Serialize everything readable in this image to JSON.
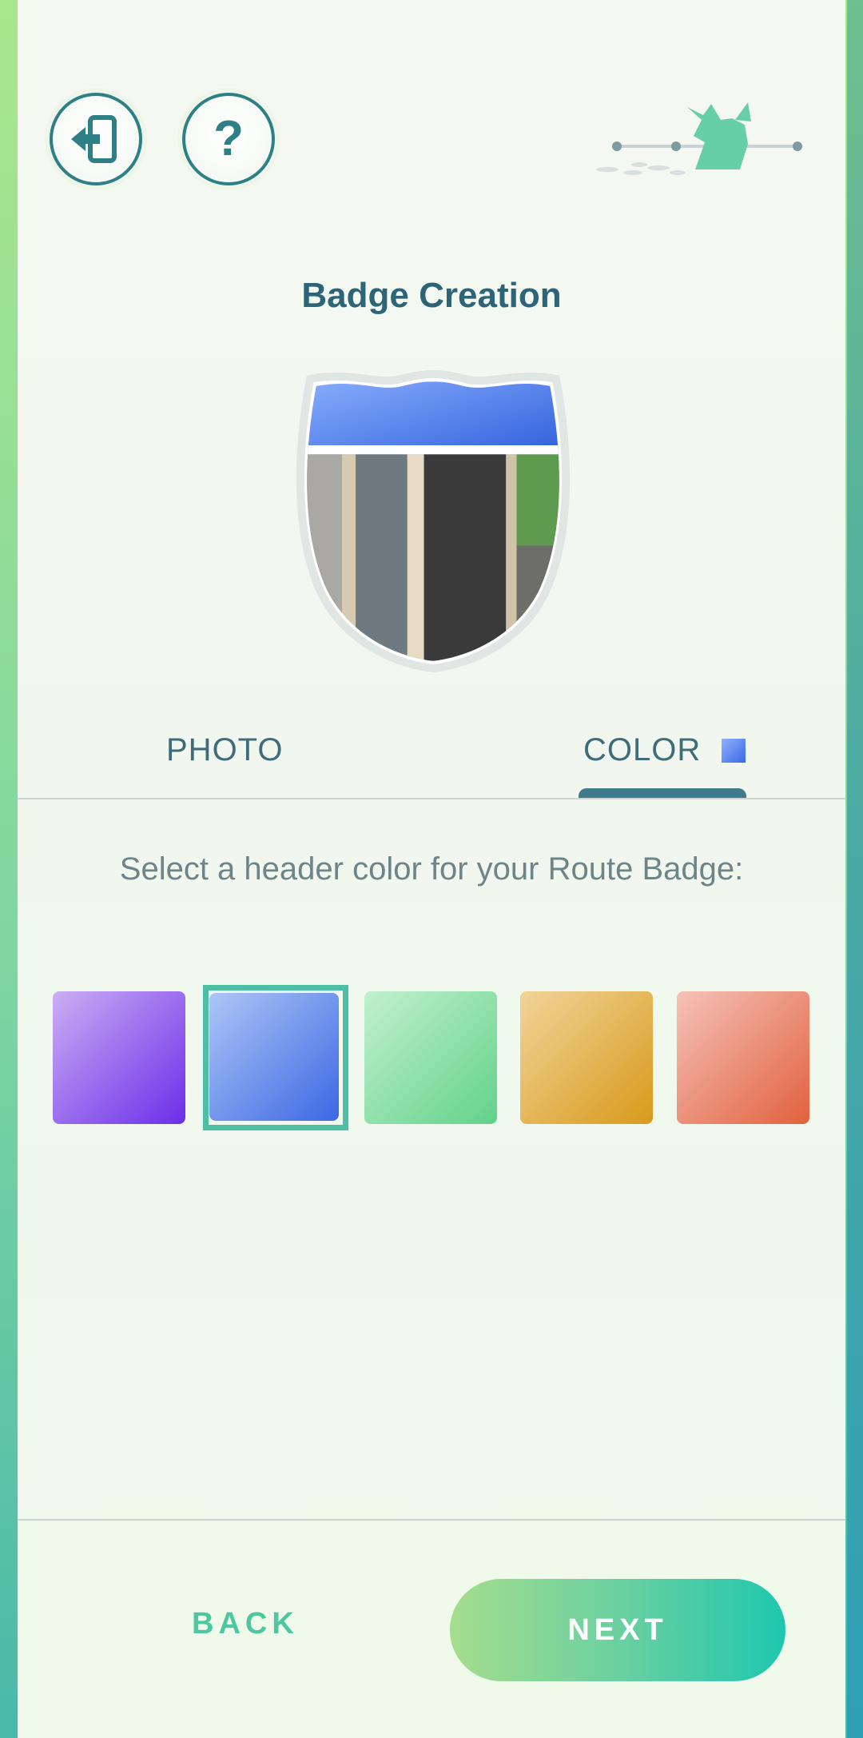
{
  "header": {
    "exit_icon": "exit-door-icon",
    "help_icon": "question-mark-icon",
    "help_glyph": "?",
    "progress_icon": "pikachu-progress-icon"
  },
  "title": "Badge Creation",
  "badge": {
    "header_color": "#4a7fe6",
    "preview_icon": "route-badge-preview"
  },
  "tabs": [
    {
      "label": "PHOTO",
      "selected": false
    },
    {
      "label": "COLOR",
      "selected": true
    }
  ],
  "instruction": "Select a header color for your Route Badge:",
  "swatches": [
    {
      "name": "purple",
      "from": "#cdaef5",
      "to": "#6a2ee8",
      "selected": false
    },
    {
      "name": "blue",
      "from": "#aec6f5",
      "to": "#3c68e4",
      "selected": true
    },
    {
      "name": "green",
      "from": "#c2f0cd",
      "to": "#62d28a",
      "selected": false
    },
    {
      "name": "gold",
      "from": "#f1d49a",
      "to": "#d89a1a",
      "selected": false
    },
    {
      "name": "coral",
      "from": "#f5c2b8",
      "to": "#e2613e",
      "selected": false
    }
  ],
  "footer": {
    "back_label": "BACK",
    "next_label": "NEXT"
  }
}
